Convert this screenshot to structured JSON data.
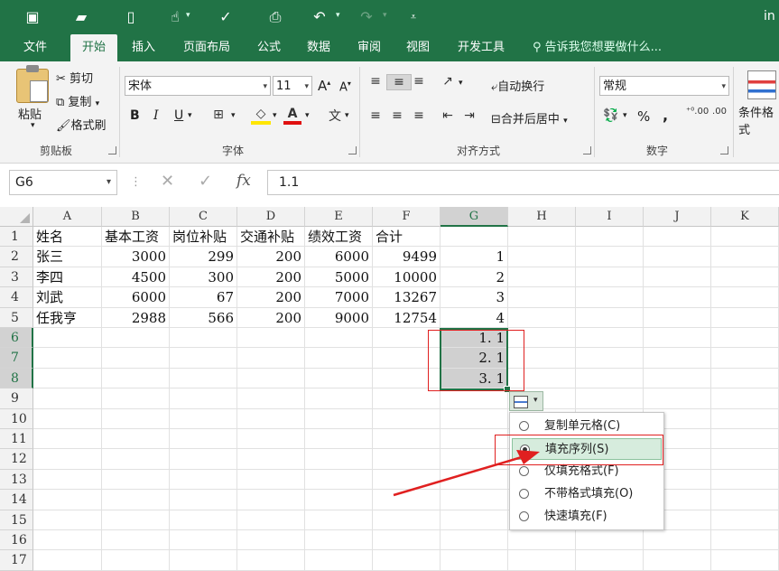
{
  "window": {
    "title_fragment": "in"
  },
  "quick_access": [
    {
      "name": "save-icon",
      "glyph": "💾"
    },
    {
      "name": "open-icon",
      "glyph": "📂"
    },
    {
      "name": "new-icon",
      "glyph": "🗋"
    },
    {
      "name": "touch-mode-icon",
      "glyph": "☝"
    },
    {
      "name": "spelling-icon",
      "glyph": "ABC"
    },
    {
      "name": "print-preview-icon",
      "glyph": "🔍"
    },
    {
      "name": "undo-icon",
      "glyph": "↶"
    },
    {
      "name": "redo-icon",
      "glyph": "↷"
    },
    {
      "name": "customize-icon",
      "glyph": "⊽"
    }
  ],
  "tabs": [
    "文件",
    "开始",
    "插入",
    "页面布局",
    "公式",
    "数据",
    "审阅",
    "视图",
    "开发工具"
  ],
  "active_tab": "开始",
  "tell_me": "告诉我您想要做什么...",
  "ribbon": {
    "clipboard": {
      "paste": "粘贴",
      "cut": "剪切",
      "copy": "复制",
      "format_painter": "格式刷",
      "label": "剪贴板"
    },
    "font": {
      "name": "宋体",
      "size": "11",
      "bold": "B",
      "italic": "I",
      "underline": "U",
      "label": "字体",
      "grow": "A",
      "shrink": "A",
      "pinyin": "文"
    },
    "alignment": {
      "wrap": "自动换行",
      "merge": "合并后居中",
      "label": "对齐方式"
    },
    "number": {
      "format": "常规",
      "percent": "%",
      "comma": ",",
      "label": "数字"
    },
    "styles": {
      "conditional": "条件格式"
    }
  },
  "formula_bar": {
    "name_box": "G6",
    "fx": "fx",
    "value": "1.1"
  },
  "columns": [
    "A",
    "B",
    "C",
    "D",
    "E",
    "F",
    "G",
    "H",
    "I",
    "J",
    "K"
  ],
  "selected_column": "G",
  "rows": [
    "1",
    "2",
    "3",
    "4",
    "5",
    "6",
    "7",
    "8",
    "9",
    "10",
    "11",
    "12",
    "13",
    "14",
    "15",
    "16",
    "17"
  ],
  "selected_rows": [
    "6",
    "7",
    "8"
  ],
  "table": {
    "header": [
      "姓名",
      "基本工资",
      "岗位补贴",
      "交通补贴",
      "绩效工资",
      "合计"
    ],
    "data": [
      [
        "张三",
        "3000",
        "299",
        "200",
        "6000",
        "9499",
        "1"
      ],
      [
        "李四",
        "4500",
        "300",
        "200",
        "5000",
        "10000",
        "2"
      ],
      [
        "刘武",
        "6000",
        "67",
        "200",
        "7000",
        "13267",
        "3"
      ],
      [
        "任我亨",
        "2988",
        "566",
        "200",
        "9000",
        "12754",
        "4"
      ]
    ],
    "g_values": [
      "1. 1",
      "2. 1",
      "3. 1"
    ]
  },
  "autofill_menu": {
    "items": [
      "复制单元格(C)",
      "填充序列(S)",
      "仅填充格式(F)",
      "不带格式填充(O)",
      "快速填充(F)"
    ],
    "selected_index": 1
  },
  "colors": {
    "accent": "#217346",
    "annotation": "#e02020"
  }
}
